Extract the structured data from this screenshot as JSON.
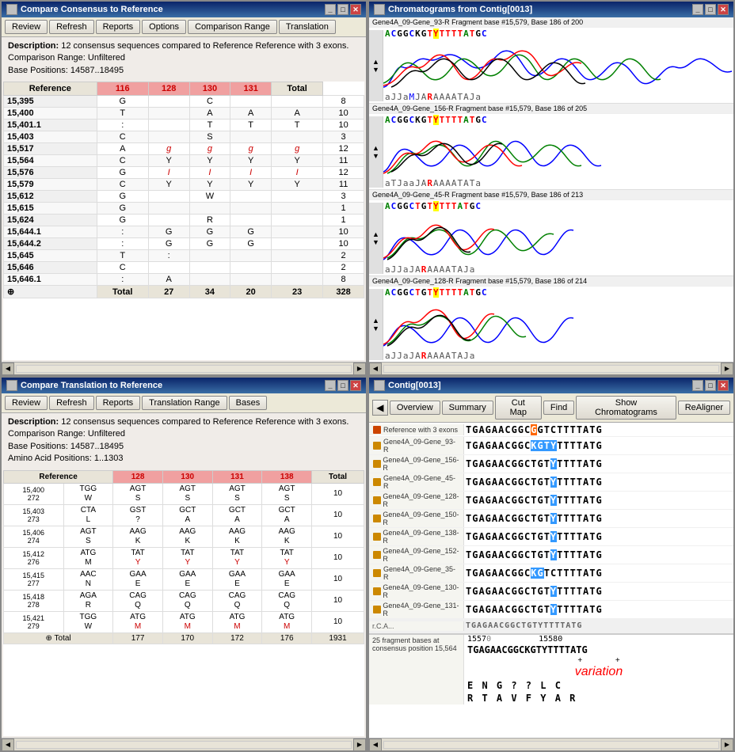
{
  "windows": {
    "compare_consensus": {
      "title": "Compare Consensus to Reference",
      "buttons": [
        "Review",
        "Refresh",
        "Reports",
        "Options",
        "Comparison Range",
        "Translation"
      ],
      "description": "Description: 12 consensus sequences compared to Reference Reference with 3 exons.",
      "comparison_range": "Comparison Range: Unfiltered",
      "base_positions": "Base Positions: 14587..18495",
      "columns": [
        "Reference",
        "116",
        "128",
        "130",
        "131",
        "Total"
      ],
      "rows": [
        {
          "pos": "15,395",
          "ref": "G",
          "c116": "",
          "c128": "C",
          "c130": "",
          "c131": "",
          "total": "8"
        },
        {
          "pos": "15,400",
          "ref": "T",
          "c116": "",
          "c128": "A",
          "c130": "A",
          "c131": "A",
          "total": "10"
        },
        {
          "pos": "15,401.1",
          "ref": ":",
          "c116": "",
          "c128": "T",
          "c130": "T",
          "c131": "T",
          "total": "10"
        },
        {
          "pos": "15,403",
          "ref": "C",
          "c116": "",
          "c128": "S",
          "c130": "",
          "c131": "",
          "total": "3"
        },
        {
          "pos": "15,517",
          "ref": "A",
          "c116": "g",
          "c128": "g",
          "c130": "g",
          "c131": "g",
          "total": "12"
        },
        {
          "pos": "15,564",
          "ref": "C",
          "c116": "Y",
          "c128": "Y",
          "c130": "Y",
          "c131": "Y",
          "total": "11"
        },
        {
          "pos": "15,576",
          "ref": "G",
          "c116": "I",
          "c128": "I",
          "c130": "I",
          "c131": "I",
          "total": "12"
        },
        {
          "pos": "15,579",
          "ref": "C",
          "c116": "Y",
          "c128": "Y",
          "c130": "Y",
          "c131": "Y",
          "total": "11"
        },
        {
          "pos": "15,612",
          "ref": "G",
          "c116": "",
          "c128": "W",
          "c130": "",
          "c131": "",
          "total": "3"
        },
        {
          "pos": "15,615",
          "ref": "G",
          "c116": "",
          "c128": "",
          "c130": "",
          "c131": "",
          "total": "1"
        },
        {
          "pos": "15,624",
          "ref": "G",
          "c116": "",
          "c128": "R",
          "c130": "",
          "c131": "",
          "total": "1"
        },
        {
          "pos": "15,644.1",
          "ref": ":",
          "c116": "G",
          "c128": "G",
          "c130": "G",
          "c131": "",
          "total": "10"
        },
        {
          "pos": "15,644.2",
          "ref": ":",
          "c116": "G",
          "c128": "G",
          "c130": "G",
          "c131": "",
          "total": "10"
        },
        {
          "pos": "15,645",
          "ref": "T",
          "c116": ":",
          "c128": "",
          "c130": "",
          "c131": "",
          "total": "2"
        },
        {
          "pos": "15,646",
          "ref": "C",
          "c116": "",
          "c128": "",
          "c130": "",
          "c131": "",
          "total": "2"
        },
        {
          "pos": "15,646.1",
          "ref": ":",
          "c116": "A",
          "c128": "",
          "c130": "",
          "c131": "",
          "total": "8"
        }
      ],
      "totals": {
        "label": "Total",
        "c116": "27",
        "c128": "34",
        "c130": "20",
        "c131": "23",
        "grand": "328"
      }
    },
    "chromatograms": {
      "title": "Chromatograms from Contig[0013]",
      "lanes": [
        {
          "label": "Gene4A_09-Gene_93-R Fragment base #15,579, Base 186 of 200",
          "bases_top": "A C G G C K G T Y T T T T A T G C",
          "bases_bot": "a J J a M J A R A A A A T A J a"
        },
        {
          "label": "Gene4A_09-Gene_156-R Fragment base #15,579, Base 186 of 205",
          "bases_top": "A C G G C K G T Y T T T T A T G C",
          "bases_bot": "a T J a a J A R A A A A T A T a"
        },
        {
          "label": "Gene4A_09-Gene_45-R Fragment base #15,579, Base 186 of 213",
          "bases_top": "A C G G C T G T Y T T T A T G C",
          "bases_bot": "a J J a J A R A A A A T A J a"
        },
        {
          "label": "Gene4A_09-Gene_128-R Fragment base #15,579, Base 186 of 214",
          "bases_top": "A C G G C T G T Y T T T T A T G C",
          "bases_bot": "a J J a J A R A A A A T A J a"
        }
      ]
    },
    "compare_translation": {
      "title": "Compare Translation to Reference",
      "buttons": [
        "Review",
        "Refresh",
        "Reports",
        "Translation Range",
        "Bases"
      ],
      "description": "Description: 12 consensus sequences compared to Reference Reference with 3 exons.",
      "comparison_range": "Comparison Range: Unfiltered",
      "base_positions": "Base Positions: 14587..18495",
      "amino_positions": "Amino Acid Positions: 1..1303",
      "columns": [
        "Reference",
        "128",
        "130",
        "131",
        "138",
        "Total"
      ],
      "rows": [
        {
          "pos1": "15,400",
          "pos2": "272",
          "ref1": "TGG",
          "ref2": "W",
          "c128_1": "AGT",
          "c128_2": "S",
          "c130_1": "AGT",
          "c130_2": "S",
          "c131_1": "AGT",
          "c131_2": "S",
          "c138_1": "AGT",
          "c138_2": "S",
          "total": "10"
        },
        {
          "pos1": "15,403",
          "pos2": "273",
          "ref1": "CTA",
          "ref2": "L",
          "c128_1": "GST",
          "c128_2": "?",
          "c130_1": "GCT",
          "c130_2": "A",
          "c131_1": "GCT",
          "c131_2": "A",
          "c138_1": "GCT",
          "c138_2": "A",
          "total": "10"
        },
        {
          "pos1": "15,406",
          "pos2": "274",
          "ref1": "AGT",
          "ref2": "S",
          "c128_1": "AAG",
          "c128_2": "K",
          "c130_1": "AAG",
          "c130_2": "K",
          "c131_1": "AAG",
          "c131_2": "K",
          "c138_1": "AAG",
          "c138_2": "K",
          "total": "10"
        },
        {
          "pos1": "15,412",
          "pos2": "276",
          "ref1": "ATG",
          "ref2": "M",
          "c128_1": "TAT",
          "c128_2": "Y",
          "c130_1": "TAT",
          "c130_2": "Y",
          "c131_1": "TAT",
          "c131_2": "Y",
          "c138_1": "TAT",
          "c138_2": "Y",
          "total": "10"
        },
        {
          "pos1": "15,415",
          "pos2": "277",
          "ref1": "AAC",
          "ref2": "N",
          "c128_1": "GAA",
          "c128_2": "E",
          "c130_1": "GAA",
          "c130_2": "E",
          "c131_1": "GAA",
          "c131_2": "E",
          "c138_1": "GAA",
          "c138_2": "E",
          "total": "10"
        },
        {
          "pos1": "15,418",
          "pos2": "278",
          "ref1": "AGA",
          "ref2": "R",
          "c128_1": "CAG",
          "c128_2": "Q",
          "c130_1": "CAG",
          "c130_2": "Q",
          "c131_1": "CAG",
          "c131_2": "Q",
          "c138_1": "CAG",
          "c138_2": "Q",
          "total": "10"
        },
        {
          "pos1": "15,421",
          "pos2": "279",
          "ref1": "TGG",
          "ref2": "W",
          "c128_1": "ATG",
          "c128_2": "M",
          "c130_1": "ATG",
          "c130_2": "M",
          "c131_1": "ATG",
          "c131_2": "M",
          "c138_1": "ATG",
          "c138_2": "M",
          "total": "10"
        }
      ],
      "totals": {
        "label": "Total",
        "c128": "177",
        "c130": "170",
        "c131": "172",
        "c138": "176",
        "grand": "1931"
      }
    },
    "contig": {
      "title": "Contig[0013]",
      "nav_buttons": [
        "Overview",
        "Summary",
        "Cut Map",
        "Find",
        "Show Chromatograms",
        "ReAligner"
      ],
      "sequences": [
        {
          "label": "Reference with 3 exons",
          "seq": "TGAGAACGGCGGTCTTTTATG",
          "highlight_pos": [
            12
          ],
          "highlight_char": "G"
        },
        {
          "label": "Gene4A_09-Gene_93-R",
          "seq": "TGAGAACGGCKGTYTTTTАТG",
          "highlight_pos": [
            12,
            13,
            14
          ],
          "hl": "blue"
        },
        {
          "label": "Gene4A_09-Gene_156-R",
          "seq": "TGAGAACGGCTGTYТТТTАТG",
          "highlight_pos": [
            14
          ],
          "hl": "blue"
        },
        {
          "label": "Gene4A_09-Gene_45-R",
          "seq": "TGAGAACGGCTGTYTТТТАТG",
          "highlight_pos": [
            14
          ],
          "hl": "blue"
        },
        {
          "label": "Gene4A_09-Gene_128-R",
          "seq": "TGAGAACGGCTGTYTTTTАТG",
          "highlight_pos": [
            14
          ],
          "hl": "blue"
        },
        {
          "label": "Gene4A_09-Gene_150-R",
          "seq": "TGAGAACGGCTGTYTTTTАТG",
          "highlight_pos": [
            14
          ],
          "hl": "blue"
        },
        {
          "label": "Gene4A_09-Gene_138-R",
          "seq": "TGAGAACGGCTGTYTTTTАТG",
          "highlight_pos": [
            14
          ],
          "hl": "blue"
        },
        {
          "label": "Gene4A_09-Gene_152-R",
          "seq": "TGAGAACGGCTGTYTTTTАТG",
          "highlight_pos": [
            14
          ],
          "hl": "blue"
        },
        {
          "label": "Gene4A_09-Gene_35-R",
          "seq": "TGAGAACGGCKGTCTTTTATG",
          "highlight_pos": [
            12,
            13
          ],
          "hl": "blue"
        },
        {
          "label": "Gene4A_09-Gene_130-R",
          "seq": "TGAGAACGGCTGTYTTTTАТG",
          "highlight_pos": [
            14
          ],
          "hl": "blue"
        },
        {
          "label": "Gene4A_09-Gene_131-R",
          "seq": "TGAGAACGGCTGTYTTTTАТG",
          "highlight_pos": [
            14
          ],
          "hl": "blue"
        }
      ],
      "consensus_label": "25 fragment bases at consensus position 15,564",
      "consensus_seq": "TGAGAACGGCKGTYTTTTАТG",
      "position_start": "15570",
      "position_end": "15580",
      "variation": "variation",
      "amino_row1": "E  N  G  ?  ?  L  C",
      "amino_row2": "R  T  A  V  F  Y  A  R"
    }
  }
}
